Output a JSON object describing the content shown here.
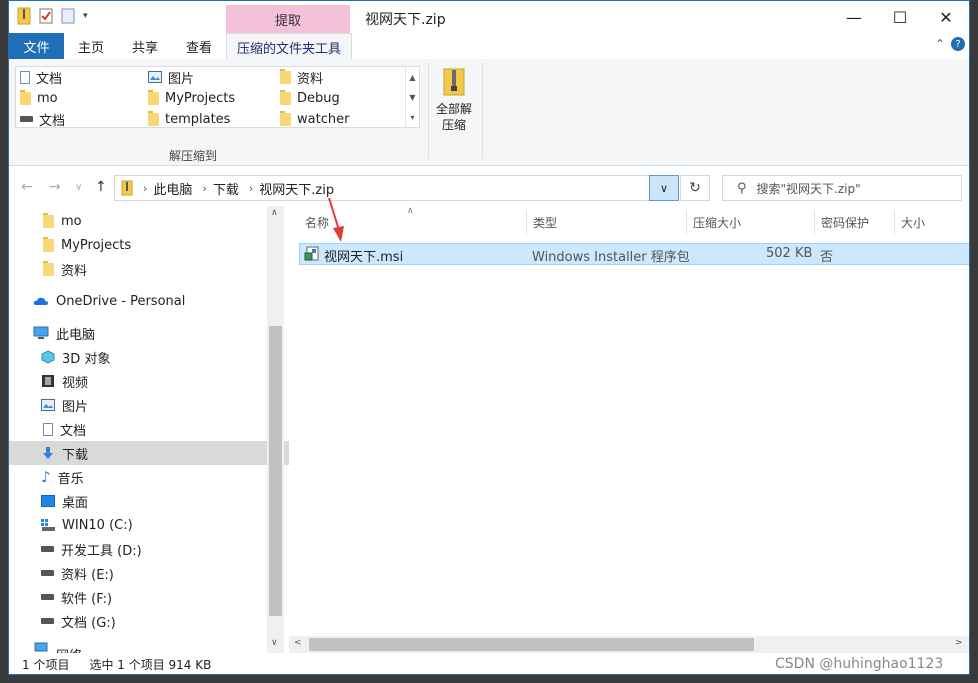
{
  "titlebar": {
    "tool_label": "提取",
    "title": "视网天下.zip",
    "minimize": "—",
    "maximize": "☐",
    "close": "✕"
  },
  "ribbon_tabs": {
    "file": "文件",
    "home": "主页",
    "share": "共享",
    "view": "查看",
    "compressed_tools": "压缩的文件夹工具"
  },
  "ribbon": {
    "gallery": [
      {
        "label": "文档",
        "icon": "document-icon"
      },
      {
        "label": "图片",
        "icon": "pictures-icon"
      },
      {
        "label": "资料",
        "icon": "folder-icon"
      },
      {
        "label": "mo",
        "icon": "folder-icon"
      },
      {
        "label": "MyProjects",
        "icon": "folder-icon"
      },
      {
        "label": "Debug",
        "icon": "folder-icon"
      },
      {
        "label": "文档",
        "icon": "drive-icon"
      },
      {
        "label": "templates",
        "icon": "folder-icon"
      },
      {
        "label": "watcher",
        "icon": "folder-icon"
      }
    ],
    "group_label": "解压缩到",
    "extract_all_line1": "全部解",
    "extract_all_line2": "压缩"
  },
  "address": {
    "crumbs": [
      "此电脑",
      "下载",
      "视网天下.zip"
    ],
    "search_placeholder": "搜索\"视网天下.zip\""
  },
  "nav": {
    "items": [
      {
        "label": "mo",
        "icon": "folder-icon"
      },
      {
        "label": "MyProjects",
        "icon": "folder-icon"
      },
      {
        "label": "资料",
        "icon": "folder-icon"
      },
      {
        "label": "OneDrive - Personal",
        "icon": "onedrive-icon"
      },
      {
        "label": "此电脑",
        "icon": "this-pc-icon"
      },
      {
        "label": "3D 对象",
        "icon": "3d-objects-icon"
      },
      {
        "label": "视频",
        "icon": "videos-icon"
      },
      {
        "label": "图片",
        "icon": "pictures-icon"
      },
      {
        "label": "文档",
        "icon": "document-icon"
      },
      {
        "label": "下载",
        "icon": "downloads-icon"
      },
      {
        "label": "音乐",
        "icon": "music-icon"
      },
      {
        "label": "桌面",
        "icon": "desktop-icon"
      },
      {
        "label": "WIN10 (C:)",
        "icon": "windows-drive-icon"
      },
      {
        "label": "开发工具 (D:)",
        "icon": "drive-icon"
      },
      {
        "label": "资料 (E:)",
        "icon": "drive-icon"
      },
      {
        "label": "软件 (F:)",
        "icon": "drive-icon"
      },
      {
        "label": "文档 (G:)",
        "icon": "drive-icon"
      },
      {
        "label": "网络",
        "icon": "network-icon"
      }
    ]
  },
  "columns": {
    "name": "名称",
    "type": "类型",
    "compressed_size": "压缩大小",
    "password": "密码保护",
    "size": "大小"
  },
  "files": [
    {
      "name": "视网天下.msi",
      "type": "Windows Installer 程序包",
      "compressed_size": "502 KB",
      "password": "否"
    }
  ],
  "status": {
    "count": "1 个项目",
    "selected": "选中 1 个项目  914 KB"
  },
  "watermark": "CSDN @huhinghao1123",
  "colors": {
    "accent": "#1f6fb8",
    "tool_tab": "#f3c2d6",
    "selection": "#cce8ff"
  }
}
